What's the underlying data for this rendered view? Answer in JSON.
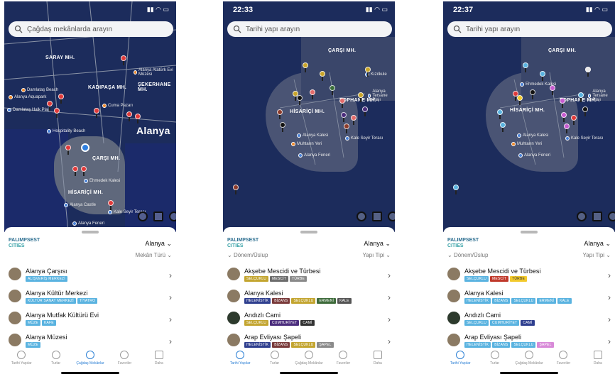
{
  "screens": [
    {
      "status_time": "",
      "search_placeholder": "Çağdaş mekânlarda arayın",
      "map_labels": [
        "SARAY MH.",
        "KADIPAŞA MH.",
        "ŞEKERHANE MH.",
        "ÇARŞI MH.",
        "HİSARİÇİ MH.",
        "Alanya"
      ],
      "pois": [
        "Damlataş Beach",
        "Alanya Aquapark",
        "Damlataş Halk Plajı",
        "Cuma Pazarı",
        "Alanya Atatürk Evi Müzesi",
        "Hospitality Beach",
        "Ehmedek Kalesi",
        "Alanya Castle",
        "Kale Seyir Terası",
        "Alanya Feneri"
      ],
      "city": "Alanya",
      "filter_left": "",
      "filter_right": "Mekân Türü",
      "items": [
        {
          "title": "Alanya Çarşısı",
          "tags": [
            {
              "text": "ALIŞVERİŞ MERKEZİ",
              "cls": "t-shop"
            }
          ]
        },
        {
          "title": "Alanya Kültür Merkezi",
          "tags": [
            {
              "text": "KÜLTÜR SANAT MERKEZİ",
              "cls": "t-shop"
            },
            {
              "text": "TİYATRO",
              "cls": "t-shop"
            }
          ]
        },
        {
          "title": "Alanya Mutfak Kültürü Evi",
          "tags": [
            {
              "text": "MÜZE",
              "cls": "t-shop"
            },
            {
              "text": "KAFE",
              "cls": "t-shop"
            }
          ]
        },
        {
          "title": "Alanya Müzesi",
          "tags": [
            {
              "text": "MÜZE",
              "cls": "t-shop"
            }
          ]
        }
      ],
      "active_tab": 2
    },
    {
      "status_time": "22:33",
      "search_placeholder": "Tarihi yapı arayın",
      "map_labels": [
        "ÇARŞI MH.",
        "HİSARİÇİ MH.",
        "TOPHANE MH."
      ],
      "pois": [
        "Alanya Kalesi",
        "Muhtarın Yeri",
        "Alanya Feneri",
        "Kale Seyir Terası",
        "Kızılkule",
        "Alanya Tersane Plajı"
      ],
      "city": "Alanya",
      "filter_left": "Dönem/Üslup",
      "filter_right": "Yapı Tipi",
      "items": [
        {
          "title": "Akşebe Mescidi ve Türbesi",
          "tags": [
            {
              "text": "SELÇUKLU",
              "cls": "t-selc"
            },
            {
              "text": "MESCİT",
              "cls": "t-mescit"
            },
            {
              "text": "TÜRBE",
              "cls": "t-turbe"
            }
          ]
        },
        {
          "title": "Alanya Kalesi",
          "tags": [
            {
              "text": "HELENİSTİK",
              "cls": "t-helen"
            },
            {
              "text": "BİZANS",
              "cls": "t-bizans"
            },
            {
              "text": "SELÇUKLU",
              "cls": "t-selc"
            },
            {
              "text": "ERMENİ",
              "cls": "t-erm"
            },
            {
              "text": "KALE",
              "cls": "t-kale"
            }
          ]
        },
        {
          "title": "Andızlı Cami",
          "tags": [
            {
              "text": "SELÇUKLU",
              "cls": "t-selc"
            },
            {
              "text": "CUMHURİYET",
              "cls": "t-cum"
            },
            {
              "text": "CAMİ",
              "cls": "t-cami"
            }
          ]
        },
        {
          "title": "Arap Evliyası Şapeli",
          "tags": [
            {
              "text": "HELENİSTİK",
              "cls": "t-helen"
            },
            {
              "text": "BİZANS",
              "cls": "t-bizans"
            },
            {
              "text": "SELÇUKLU",
              "cls": "t-selc"
            },
            {
              "text": "ŞAPEL",
              "cls": "t-sapel"
            }
          ]
        }
      ],
      "active_tab": 0
    },
    {
      "status_time": "22:37",
      "search_placeholder": "Tarihi yapı arayın",
      "map_labels": [
        "ÇARŞI MH.",
        "HİSARİÇİ MH.",
        "TOPHANE MH."
      ],
      "pois": [
        "Alanya Kalesi",
        "Muhtarın Yeri",
        "Alanya Feneri",
        "Kale Seyir Terası",
        "Ehmedek Kalesi",
        "Alanya Tersane Plajı"
      ],
      "city": "Alanya",
      "filter_left": "Dönem/Üslup",
      "filter_right": "Yapı Tipi",
      "items": [
        {
          "title": "Akşebe Mescidi ve Türbesi",
          "tags": [
            {
              "text": "SELÇUKLU",
              "cls": "t-selc"
            },
            {
              "text": "MESCİT",
              "cls": "t-mescit"
            },
            {
              "text": "TÜRBE",
              "cls": "t-turbe"
            }
          ]
        },
        {
          "title": "Alanya Kalesi",
          "tags": [
            {
              "text": "HELENİSTİK",
              "cls": "t-helen"
            },
            {
              "text": "BİZANS",
              "cls": "t-bizans"
            },
            {
              "text": "SELÇUKLU",
              "cls": "t-selc"
            },
            {
              "text": "ERMENİ",
              "cls": "t-erm"
            },
            {
              "text": "KALE",
              "cls": "t-kale"
            }
          ]
        },
        {
          "title": "Andızlı Cami",
          "tags": [
            {
              "text": "SELÇUKLU",
              "cls": "t-selc"
            },
            {
              "text": "CUMHURİYET",
              "cls": "t-cum"
            },
            {
              "text": "CAMİ",
              "cls": "t-cami"
            }
          ]
        },
        {
          "title": "Arap Evliyası Şapeli",
          "tags": [
            {
              "text": "HELENİSTİK",
              "cls": "t-helen"
            },
            {
              "text": "BİZANS",
              "cls": "t-bizans"
            },
            {
              "text": "SELÇUKLU",
              "cls": "t-selc"
            },
            {
              "text": "ŞAPEL",
              "cls": "t-sapel"
            }
          ]
        }
      ],
      "active_tab": 0
    }
  ],
  "brand": {
    "line1": "PALIMPSEST",
    "line2": "CITIES"
  },
  "tabs": [
    "Tarihi Yapılar",
    "Turlar",
    "Çağdaş Mekânlar",
    "Favoriler",
    "Daha"
  ],
  "pin_colors": {
    "screen1": [
      "#e03a3a"
    ],
    "screen2": [
      "#c9a52a",
      "#8c3b2b",
      "#4b2d7d",
      "#e36b6b",
      "#111111",
      "#3a6e3a"
    ],
    "screen3": [
      "#5ab3e0",
      "#c65bd0",
      "#e03a3a",
      "#f2c92c",
      "#111111",
      "#e8e8e8"
    ]
  }
}
